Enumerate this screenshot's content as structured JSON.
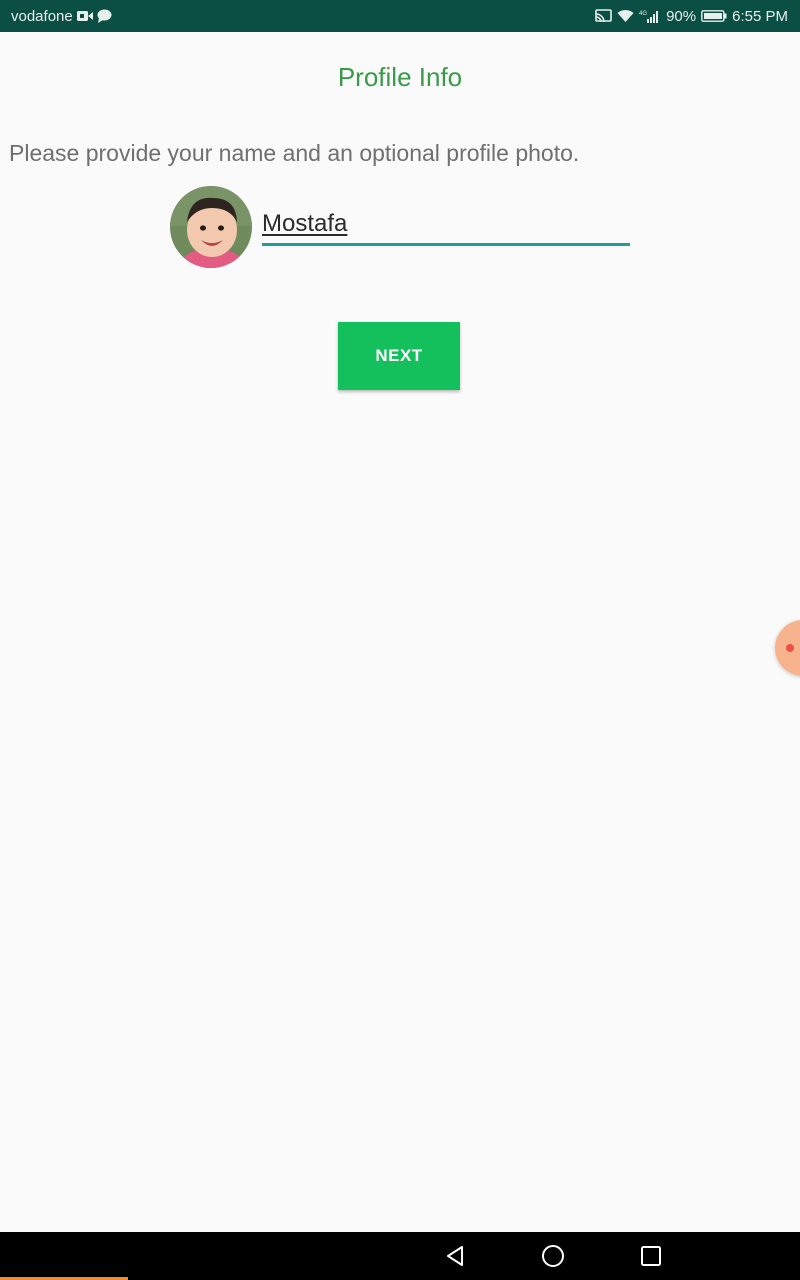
{
  "status_bar": {
    "carrier": "vodafone",
    "battery": "90%",
    "time": "6:55 PM",
    "network_label": "4G"
  },
  "screen": {
    "title": "Profile Info",
    "prompt": "Please provide your name and an optional profile photo.",
    "name_value": "Mostafa",
    "next_label": "NEXT"
  },
  "colors": {
    "status_bar_bg": "#0b4f44",
    "title": "#3a9a4a",
    "accent_underline": "#1f9f8f",
    "button_bg": "#13c05b"
  },
  "icons": {
    "status_left": [
      "video-call-icon",
      "chat-bubble-icon"
    ],
    "status_right": [
      "cast-icon",
      "wifi-icon",
      "signal-icon",
      "battery-icon"
    ],
    "nav": [
      "back-icon",
      "home-icon",
      "recent-apps-icon"
    ]
  }
}
